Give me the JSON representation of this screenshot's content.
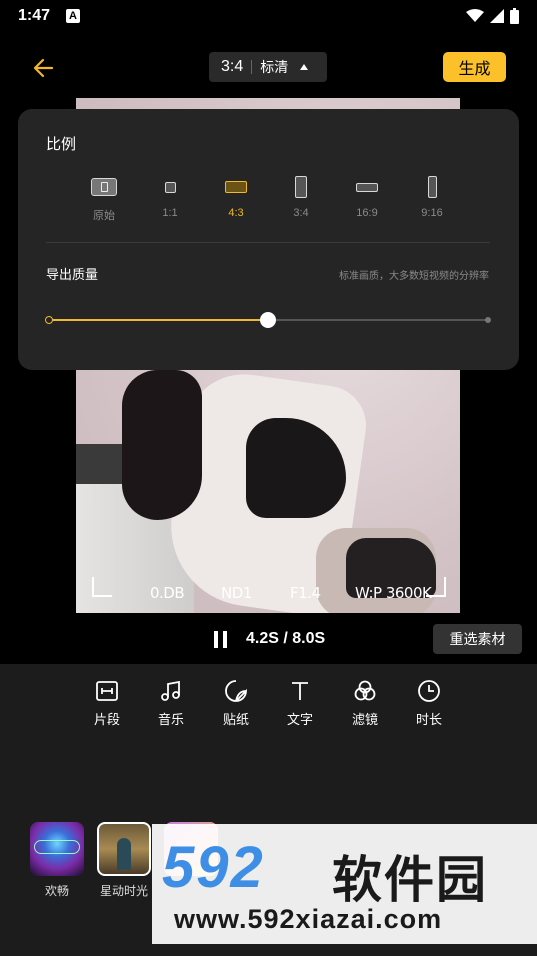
{
  "status_bar": {
    "time": "1:47",
    "notif_icon": "A"
  },
  "top_bar": {
    "back_icon": "arrow-left-icon",
    "ratio_value": "3:4",
    "quality_value": "标清",
    "generate_label": "生成"
  },
  "colors": {
    "accent": "#f0b82a",
    "generate_bg": "#fcc02a",
    "panel_bg": "#252525"
  },
  "preview": {
    "cam_overlay": [
      "0.DB",
      "ND1",
      "F1.4",
      "W:P 3600K"
    ]
  },
  "ratio_popup": {
    "title": "比例",
    "options": [
      {
        "label": "原始",
        "selected": false
      },
      {
        "label": "1:1",
        "selected": false
      },
      {
        "label": "4:3",
        "selected": true
      },
      {
        "label": "3:4",
        "selected": false
      },
      {
        "label": "16:9",
        "selected": false
      },
      {
        "label": "9:16",
        "selected": false
      }
    ],
    "quality_title": "导出质量",
    "quality_desc": "标准画质，大多数短视频的分辨率",
    "quality_level": 0.5
  },
  "playback": {
    "time": "4.2S / 8.0S",
    "reselect_label": "重选素材"
  },
  "tools": [
    {
      "label": "片段",
      "icon": "clip-icon"
    },
    {
      "label": "音乐",
      "icon": "music-icon"
    },
    {
      "label": "贴纸",
      "icon": "sticker-icon"
    },
    {
      "label": "文字",
      "icon": "text-icon"
    },
    {
      "label": "滤镜",
      "icon": "filter-icon"
    },
    {
      "label": "时长",
      "icon": "clock-icon"
    }
  ],
  "music_items": [
    {
      "label": "欢畅"
    },
    {
      "label": "星动时光"
    }
  ],
  "watermark": {
    "number": "592",
    "name": "软件园",
    "url": "www.592xiazai.com"
  }
}
